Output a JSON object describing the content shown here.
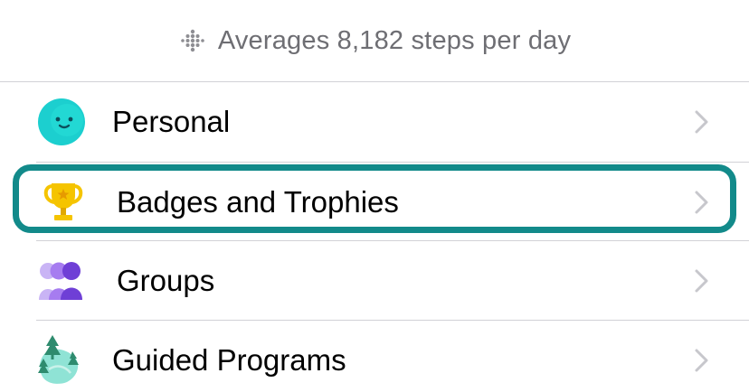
{
  "summary": {
    "icon": "fitbit-dots-icon",
    "text": "Averages 8,182 steps per day"
  },
  "menu": {
    "items": [
      {
        "label": "Personal",
        "icon": "smiley-face-icon",
        "color": "#1ccfcf"
      },
      {
        "label": "Badges and Trophies",
        "icon": "trophy-icon",
        "color": "#f5c400",
        "highlighted": true
      },
      {
        "label": "Groups",
        "icon": "people-icon",
        "color": "#7a4fd8"
      },
      {
        "label": "Guided Programs",
        "icon": "map-trees-icon",
        "color": "#6fd6c6"
      }
    ]
  },
  "colors": {
    "highlight_border": "#128a8a",
    "chevron": "#c7c7cc",
    "summary_text": "#6e6e73"
  }
}
